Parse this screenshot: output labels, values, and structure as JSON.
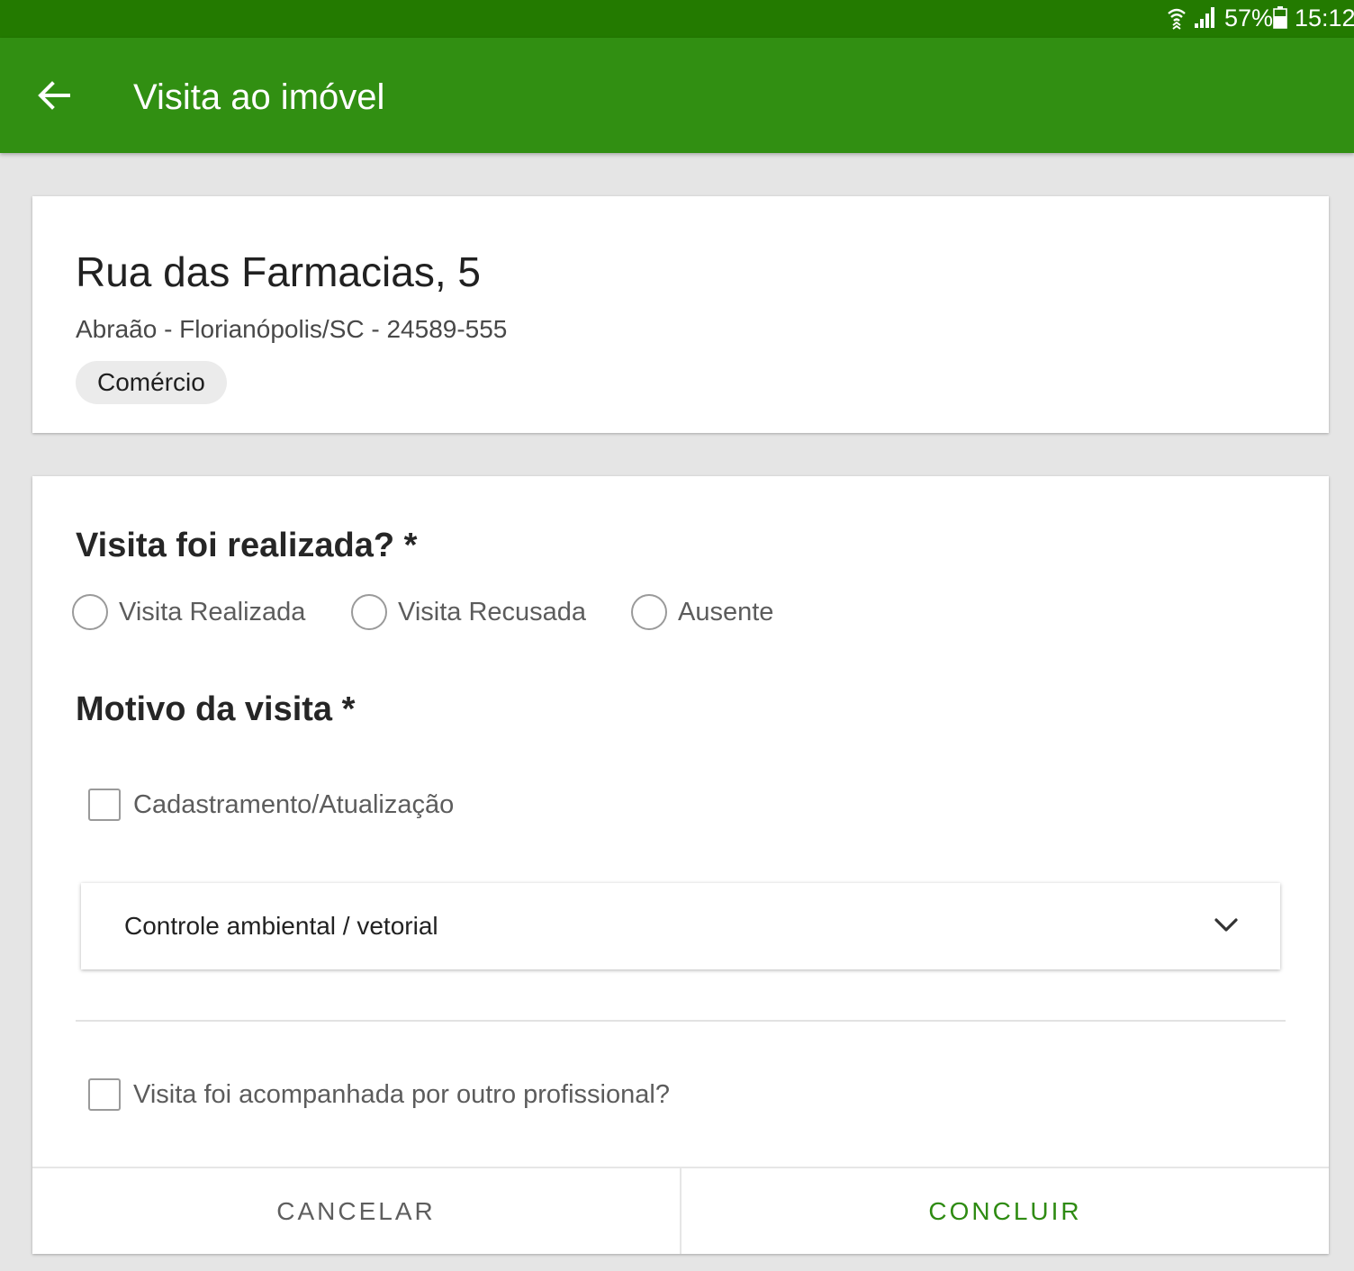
{
  "status_bar": {
    "battery": "57%",
    "time": "15:12",
    "icons": [
      "wifi-icon",
      "signal-icon",
      "battery-icon"
    ]
  },
  "app_bar": {
    "title": "Visita ao imóvel",
    "back_icon": "arrow-left-icon"
  },
  "address": {
    "street": "Rua das Farmacias, 5",
    "details": "Abraão - Florianópolis/SC - 24589-555",
    "category": "Comércio"
  },
  "form": {
    "visit_question": "Visita foi realizada? *",
    "visit_options": [
      "Visita Realizada",
      "Visita Recusada",
      "Ausente"
    ],
    "reason_title": "Motivo da visita *",
    "reason_checkbox": "Cadastramento/Atualização",
    "reason_dropdown": "Controle ambiental / vetorial",
    "accompanied_checkbox": "Visita foi acompanhada por outro profissional?"
  },
  "actions": {
    "cancel": "CANCELAR",
    "confirm": "CONCLUIR"
  },
  "colors": {
    "status_bar": "#237a00",
    "app_bar": "#318f12",
    "accent": "#2e8b12",
    "background": "#e5e5e5"
  }
}
